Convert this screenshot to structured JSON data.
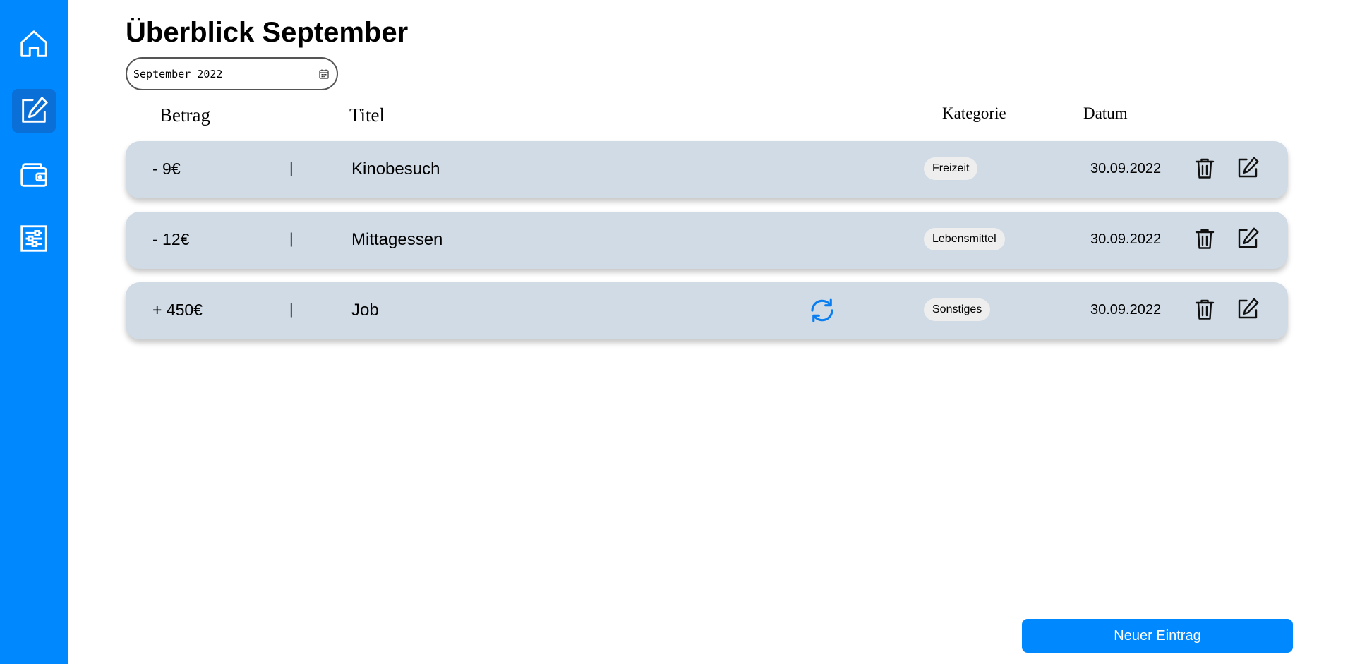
{
  "sidebar": {
    "items": [
      {
        "name": "home",
        "icon": "home-icon",
        "active": false
      },
      {
        "name": "entries",
        "icon": "edit-icon",
        "active": true
      },
      {
        "name": "wallet",
        "icon": "wallet-icon",
        "active": false
      },
      {
        "name": "settings",
        "icon": "sliders-icon",
        "active": false
      }
    ]
  },
  "header": {
    "title": "Überblick September",
    "month_picker": {
      "value": "September 2022",
      "icon": "calendar-icon"
    }
  },
  "table": {
    "columns": {
      "betrag": "Betrag",
      "titel": "Titel",
      "kategorie": "Kategorie",
      "datum": "Datum"
    },
    "rows": [
      {
        "amount": "- 9€",
        "separator": "|",
        "title": "Kinobesuch",
        "recurring": false,
        "category": "Freizeit",
        "date": "30.09.2022"
      },
      {
        "amount": "- 12€",
        "separator": "|",
        "title": "Mittagessen",
        "recurring": false,
        "category": "Lebensmittel",
        "date": "30.09.2022"
      },
      {
        "amount": "+ 450€",
        "separator": "|",
        "title": "Job",
        "recurring": true,
        "category": "Sonstiges",
        "date": "30.09.2022"
      }
    ]
  },
  "actions": {
    "new_entry": "Neuer Eintrag"
  },
  "colors": {
    "accent": "#0088ff",
    "active_nav": "#0a6fd6",
    "row_bg": "#d0dbe5",
    "badge_bg": "#eeeeee"
  }
}
